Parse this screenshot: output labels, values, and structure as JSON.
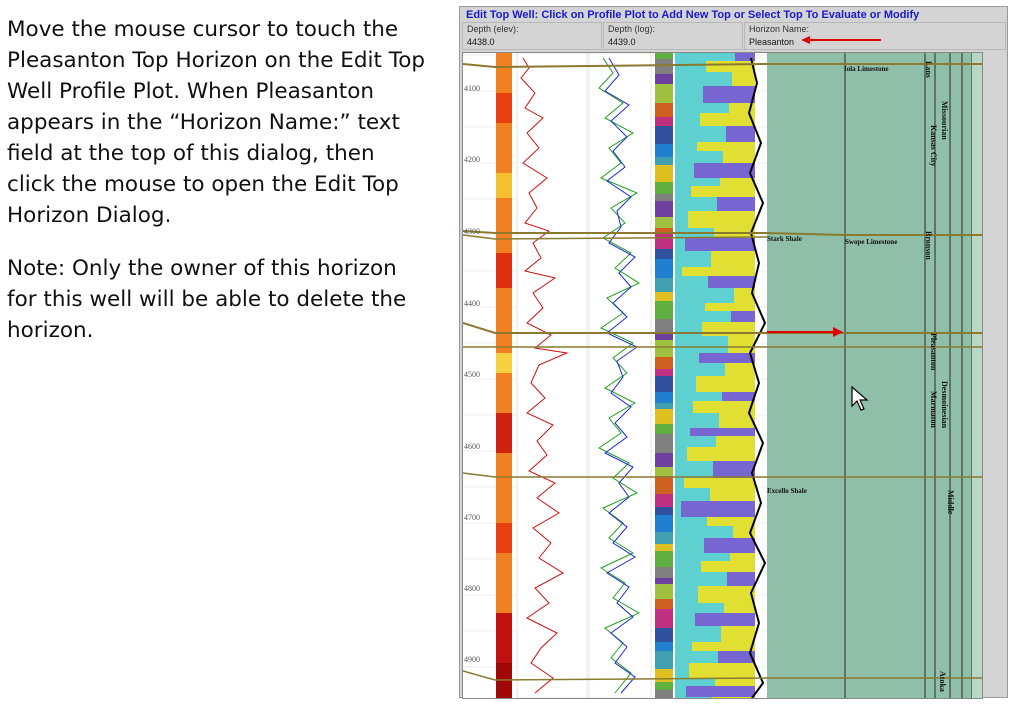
{
  "instructions": {
    "paragraph1": "Move the mouse cursor to touch the Pleasanton Top Horizon  on the Edit Top Well Profile Plot.  When Pleasanton appears in the “Horizon Name:” text field at the top of this dialog, then click the mouse to open the Edit Top Horizon Dialog.",
    "paragraph2": "Note: Only the owner of this horizon for this well will be able to delete the horizon."
  },
  "dialog": {
    "title": "Edit Top Well: Click on Profile Plot to Add New Top or Select Top To Evaluate or Modify",
    "fields": {
      "depth_elev": {
        "label": "Depth (elev):",
        "value": "4438.0"
      },
      "depth_log": {
        "label": "Depth (log):",
        "value": "4439.0"
      },
      "horizon_name": {
        "label": "Horizon Name:",
        "value": "Pleasanton"
      }
    }
  },
  "plot": {
    "depth_labels": [
      "4100",
      "4200",
      "4300",
      "4400",
      "4500",
      "4600",
      "4700",
      "4800",
      "4900"
    ],
    "tops": {
      "iola": "Iola Limestone",
      "stark": "Stark Shale",
      "swope": "Swope Limestone",
      "excello": "Excello Shale"
    },
    "strat_columns": {
      "lans": "Lans",
      "missourian": "Missourian",
      "kansas_city": "Kansas City",
      "bronson": "Bronson",
      "pleasanton": "Pleasanton",
      "desmoinesian": "Desmoinesian",
      "marmaton": "Marmaton",
      "middle": "Middle",
      "atoka": "Atoka"
    }
  },
  "colors": {
    "title_blue": "#1a1acc",
    "arrow_red": "#e00000",
    "panel_green": "#8fbfa8",
    "horizon_olive": "#8a7a30"
  }
}
